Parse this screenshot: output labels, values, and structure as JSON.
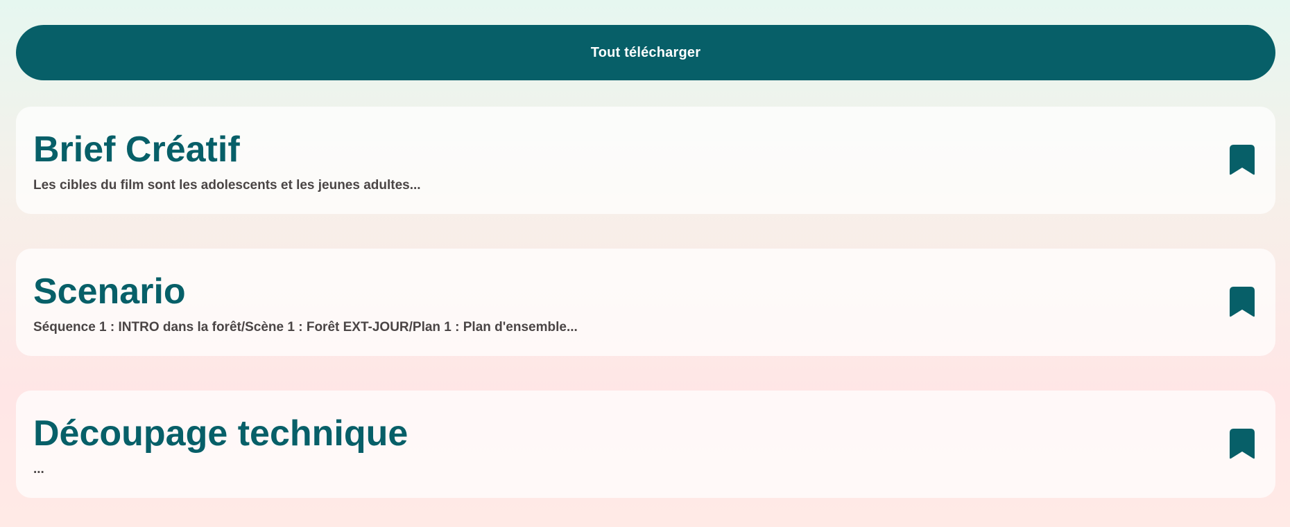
{
  "toolbar": {
    "download_all_label": "Tout télécharger"
  },
  "colors": {
    "accent": "#075f68",
    "excerpt_text": "#4a4545"
  },
  "cards": [
    {
      "title": "Brief Créatif",
      "excerpt": "Les cibles du film sont les adolescents et les jeunes adultes...",
      "icon": "bookmark-icon"
    },
    {
      "title": "Scenario",
      "excerpt": "Séquence 1 : INTRO dans la forêt/Scène 1 : Forêt EXT-JOUR/Plan 1 : Plan d'ensemble...",
      "icon": "bookmark-icon"
    },
    {
      "title": "Découpage technique",
      "excerpt": "...",
      "icon": "bookmark-icon"
    }
  ]
}
